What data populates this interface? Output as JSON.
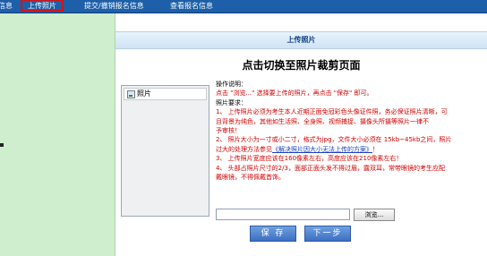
{
  "nav": {
    "partial_label": "信息",
    "items": [
      {
        "label": "上传照片",
        "active": true
      },
      {
        "label": "提交/撤销报名信息",
        "active": false
      },
      {
        "label": "查看报名信息",
        "active": false
      }
    ]
  },
  "main": {
    "section_header": "上传照片",
    "page_heading": "点击切换至照片裁剪页面",
    "photo_label": "照片",
    "instructions": {
      "op_title": "操作说明：",
      "op_text": "点击 \"浏览...\" 选择要上传的照片，再点击 \"保存\" 即可。",
      "req_title": "照片要求：",
      "req_1a": "1、 上传照片必须为考生本人近期正面免冠彩色头像证件照，务必保证照片清晰，可",
      "req_1b": "且背景为纯色，其他如生活照、全身照、视频捕捉、摄像头所摄等照片一律不",
      "req_1c": "予审核！",
      "req_2a": "2、 照片大小为一寸或小二寸，格式为jpg，文件大小必须在 15kb~45kb之间，照片",
      "req_2b_prefix": "过大的处理方法参见",
      "req_2b_link": "《解决照片因大小无法上传的方案》",
      "req_2b_suffix": "！",
      "req_3": "3、 上传照片宽度应该在160像素左右，高度应该在210像素左右！",
      "req_4a": "4、 头部占照片尺寸的2/3，面部正面头发不得过眉，露双耳，常带眼镜的考生应配",
      "req_4b": "戴眼镜，不得佩戴首饰。"
    },
    "browse_label": "浏览...",
    "save_label": "保 存",
    "next_label": "下一步"
  },
  "colors": {
    "nav_bg": "#1d5fa8",
    "active_outline": "#d1141a",
    "left_panel_bg": "#cfeecd",
    "header_text": "#0b3e86",
    "warning_text": "#d40000",
    "button_bg": "#3c6fc2"
  }
}
